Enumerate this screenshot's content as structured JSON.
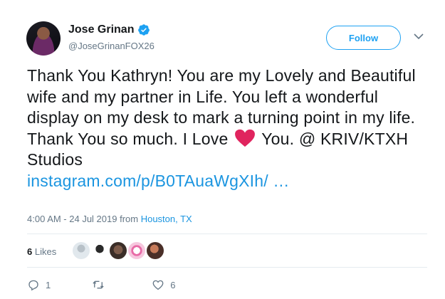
{
  "author": {
    "display_name": "Jose Grinan",
    "handle": "@JoseGrinanFOX26"
  },
  "follow_label": "Follow",
  "tweet": {
    "text_before_heart": "Thank You Kathryn! You are my Lovely and Beautiful wife and my partner in Life. You left a wonderful display on my desk to mark a turning point in my life. Thank You so much. I Love",
    "text_after_heart": " You. @ KRIV/KTXH Studios",
    "link": "instagram.com/p/B0TAuaWgXIh/ …"
  },
  "meta": {
    "time": "4:00 AM - 24 Jul 2019 from ",
    "location": "Houston, TX"
  },
  "likes": {
    "count": "6",
    "label": " Likes"
  },
  "actions": {
    "reply_count": "1",
    "retweet_count": "",
    "like_count": "6"
  },
  "colors": {
    "accent": "#1da1f2",
    "heart": "#e0245e",
    "meta_gray": "#657786"
  }
}
